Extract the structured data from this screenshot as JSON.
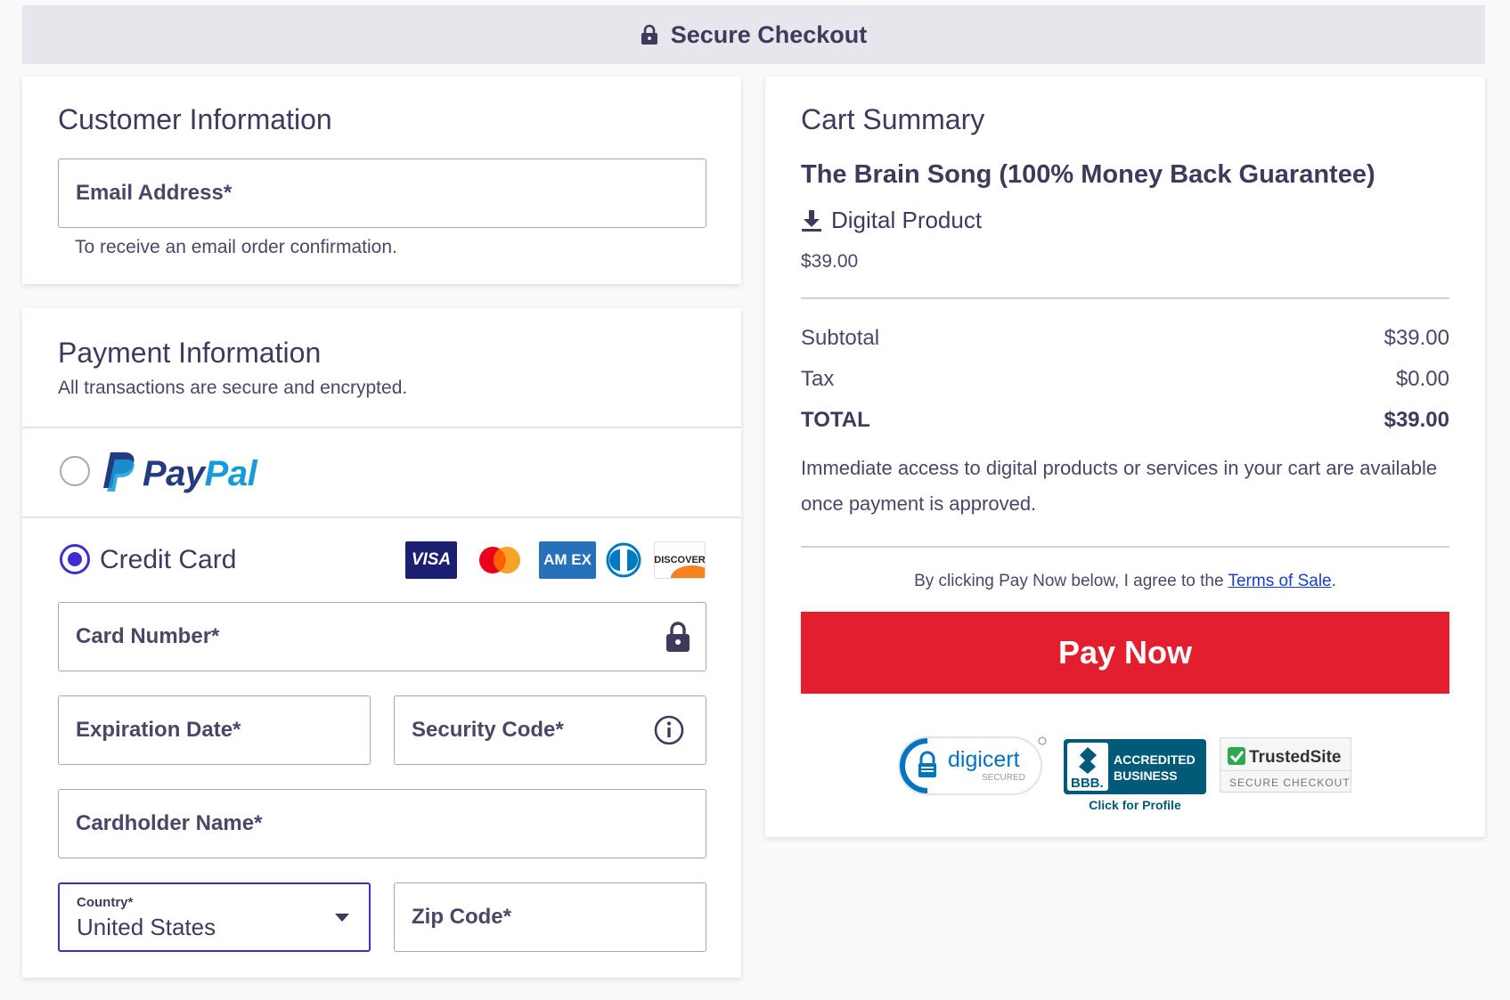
{
  "header": {
    "title": "Secure Checkout"
  },
  "customer": {
    "title": "Customer Information",
    "email_placeholder": "Email Address*",
    "email_hint": "To receive an email order confirmation."
  },
  "payment": {
    "title": "Payment Information",
    "subtitle": "All transactions are secure and encrypted.",
    "paypal": {
      "pay": "Pay",
      "pal": "Pal",
      "selected": false
    },
    "credit_card": {
      "label": "Credit Card",
      "selected": true
    },
    "card_brands": {
      "visa": "VISA",
      "amex": "AM EX",
      "discover": "DISCOVER"
    },
    "fields": {
      "card_number": "Card Number*",
      "expiration": "Expiration Date*",
      "security_code": "Security Code*",
      "cardholder": "Cardholder Name*",
      "zip": "Zip Code*"
    },
    "country": {
      "label": "Country*",
      "value": "United States"
    }
  },
  "cart": {
    "title": "Cart Summary",
    "product": "The Brain Song (100% Money Back Guarantee)",
    "product_type": "Digital Product",
    "price": "$39.00",
    "subtotal_label": "Subtotal",
    "subtotal": "$39.00",
    "tax_label": "Tax",
    "tax": "$0.00",
    "total_label": "TOTAL",
    "total": "$39.00",
    "access_note": "Immediate access to digital products or services in your cart are available once payment is approved.",
    "terms_prefix": "By clicking Pay Now below, I agree to the ",
    "terms_link": "Terms of Sale",
    "terms_suffix": ".",
    "pay_button": "Pay Now"
  },
  "badges": {
    "digicert": "digicert",
    "digicert_sub": "SECURED",
    "bbb_logo": "BBB.",
    "bbb_line1": "ACCREDITED",
    "bbb_line2": "BUSINESS",
    "bbb_click": "Click for Profile",
    "trusted_name": "TrustedSite",
    "trusted_sub": "SECURE CHECKOUT"
  },
  "colors": {
    "accent": "#3a2fd0",
    "pay_button": "#e31f2f",
    "text": "#3d3a5c",
    "link": "#1a3ec9"
  },
  "icons": {
    "header": "lock-icon",
    "card_number": "lock-icon",
    "security_code": "info-icon",
    "product_type": "download-icon",
    "country": "chevron-down-icon"
  }
}
